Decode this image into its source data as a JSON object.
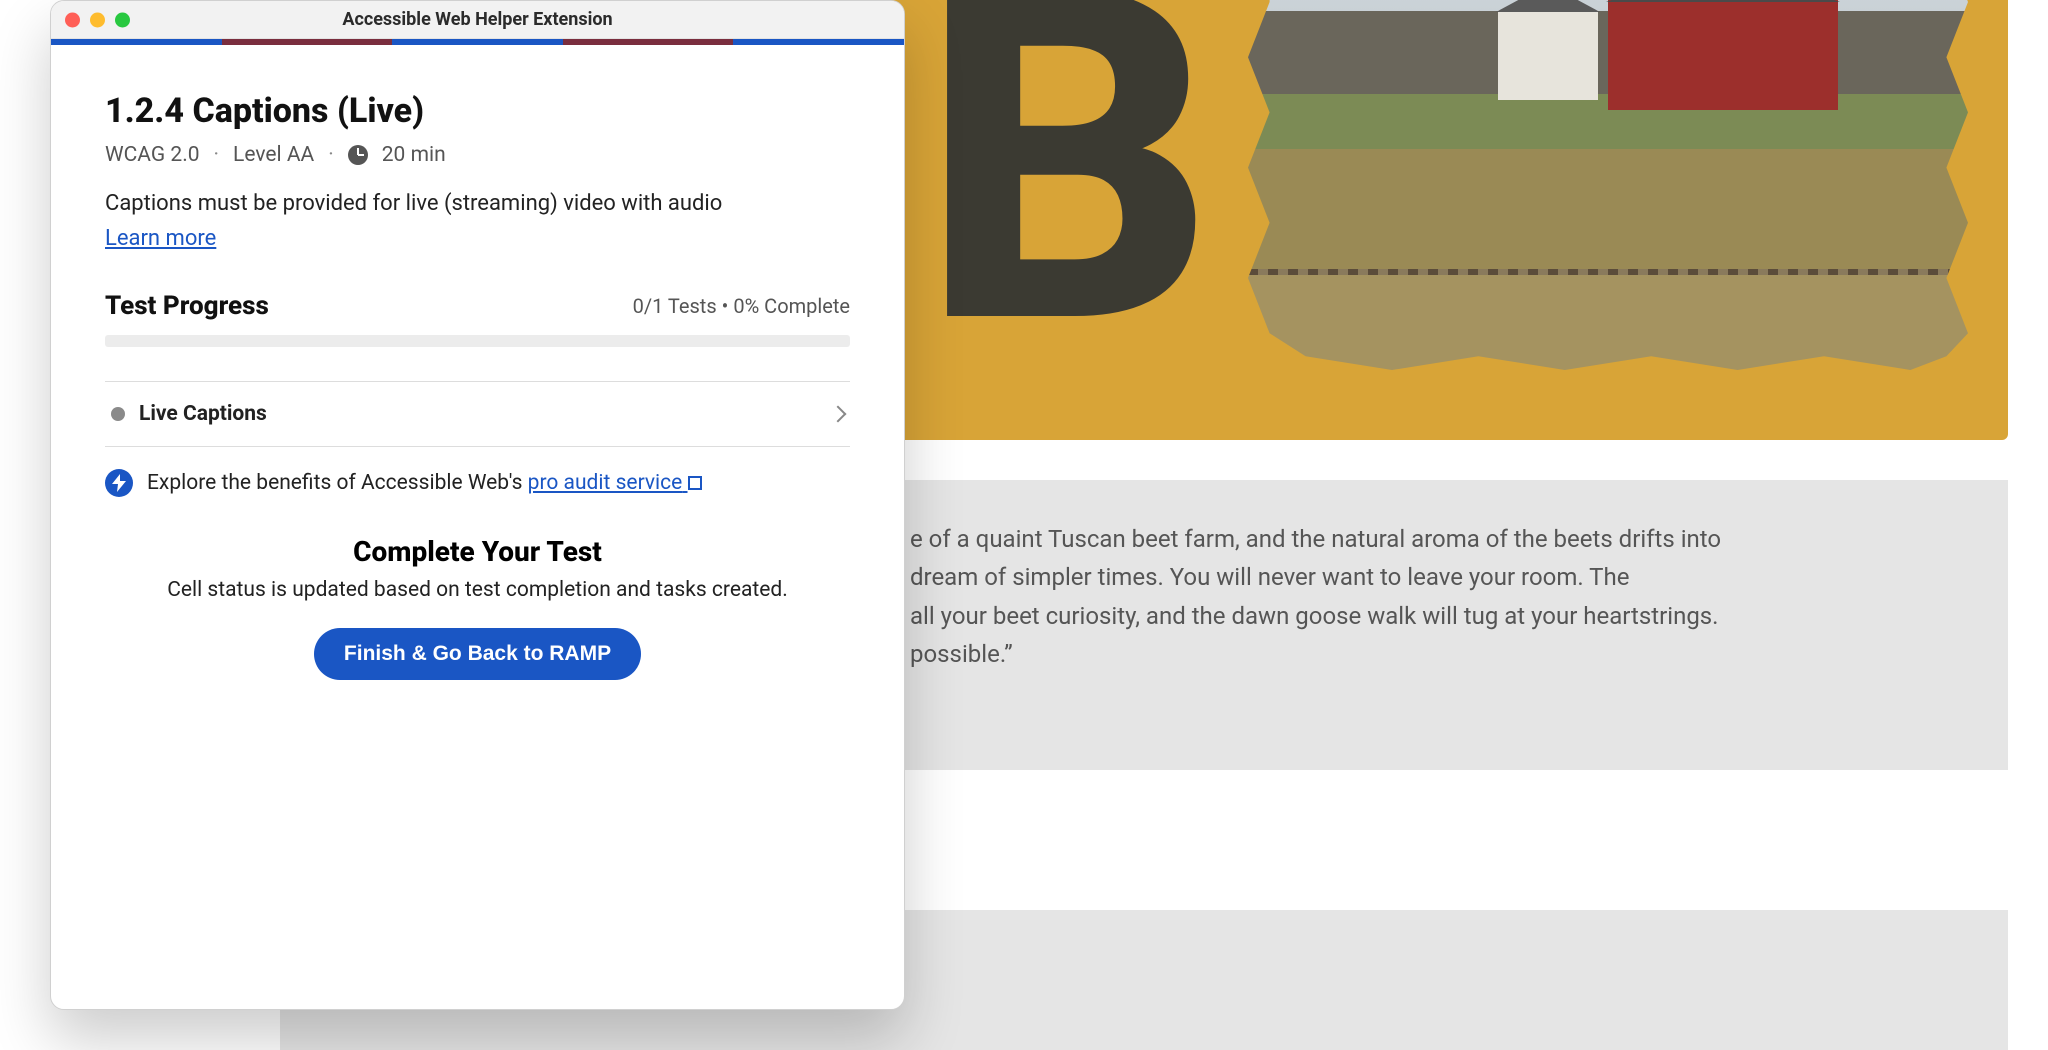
{
  "window": {
    "title": "Accessible Web Helper Extension"
  },
  "rule": {
    "title": "1.2.4 Captions (Live)",
    "wcag_version": "WCAG 2.0",
    "level": "Level AA",
    "time_estimate": "20 min",
    "description": "Captions must be provided for live (streaming) video with audio",
    "learn_more_label": "Learn more"
  },
  "progress": {
    "section_title": "Test Progress",
    "status_text": "0/1 Tests • 0% Complete",
    "percent": 0,
    "tests": [
      {
        "name": "Live Captions",
        "status": "pending"
      }
    ]
  },
  "promo": {
    "prefix": "Explore the benefits of Accessible Web's ",
    "link_text": "pro audit service"
  },
  "complete": {
    "heading": "Complete Your Test",
    "subtext": "Cell status is updated based on test completion and tasks created.",
    "button_label": "Finish & Go Back to RAMP"
  },
  "background_page": {
    "hero_letter": "B",
    "body_visible_text": "e of a quaint Tuscan beet farm, and the natural aroma of the beets drifts into\ndream of simpler times. You will never want to leave your room. The\n all your beet curiosity, and the dawn goose walk will tug at your heartstrings.\n possible.”"
  },
  "colors": {
    "brand_blue": "#1a56c4",
    "brand_maroon": "#7a2e3e",
    "hero_gold": "#d8a437"
  }
}
